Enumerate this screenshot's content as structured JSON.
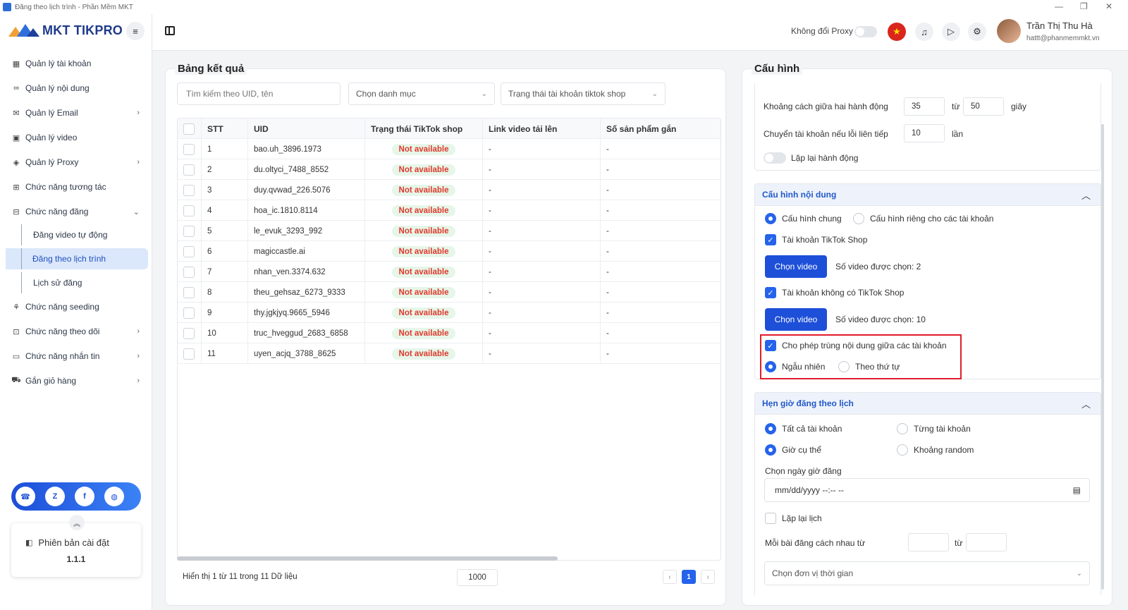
{
  "window": {
    "title": "Đăng theo lịch trình - Phần Mềm MKT"
  },
  "brand": {
    "name": "MKT TIKPRO"
  },
  "sidebar": {
    "items": [
      {
        "label": "Quản lý tài khoản"
      },
      {
        "label": "Quản lý nội dung"
      },
      {
        "label": "Quản lý Email"
      },
      {
        "label": "Quản lý video"
      },
      {
        "label": "Quản lý Proxy"
      },
      {
        "label": "Chức năng tương tác"
      },
      {
        "label": "Chức năng đăng"
      },
      {
        "label": "Chức năng seeding"
      },
      {
        "label": "Chức năng theo dõi"
      },
      {
        "label": "Chức năng nhắn tin"
      },
      {
        "label": "Gắn giỏ hàng"
      }
    ],
    "sub_items": [
      {
        "label": "Đăng video tự động"
      },
      {
        "label": "Đăng theo lịch trình"
      },
      {
        "label": "Lịch sử đăng"
      }
    ],
    "version_label": "Phiên bản cài đặt",
    "version": "1.1.1"
  },
  "topbar": {
    "proxy_label": "Không đổi Proxy",
    "user_name": "Trần Thị Thu Hà",
    "user_email": "hattt@phanmemmkt.vn"
  },
  "results": {
    "title": "Bảng kết quả",
    "search_placeholder": "Tìm kiếm theo UID, tên",
    "category_select": "Chọn danh mục",
    "status_select": "Trạng thái tài khoản tiktok shop",
    "columns": [
      "STT",
      "UID",
      "Trạng thái TikTok shop",
      "Link video tải lên",
      "Số sản phẩm gắn"
    ],
    "rows": [
      {
        "stt": "1",
        "uid": "bao.uh_3896.1973",
        "status": "Not available",
        "link": "-",
        "products": "-"
      },
      {
        "stt": "2",
        "uid": "du.oltyci_7488_8552",
        "status": "Not available",
        "link": "-",
        "products": "-"
      },
      {
        "stt": "3",
        "uid": "duy.qvwad_226.5076",
        "status": "Not available",
        "link": "-",
        "products": "-"
      },
      {
        "stt": "4",
        "uid": "hoa_ic.1810.8114",
        "status": "Not available",
        "link": "-",
        "products": "-"
      },
      {
        "stt": "5",
        "uid": "le_evuk_3293_992",
        "status": "Not available",
        "link": "-",
        "products": "-"
      },
      {
        "stt": "6",
        "uid": "magiccastle.ai",
        "status": "Not available",
        "link": "-",
        "products": "-"
      },
      {
        "stt": "7",
        "uid": "nhan_ven.3374.632",
        "status": "Not available",
        "link": "-",
        "products": "-"
      },
      {
        "stt": "8",
        "uid": "theu_gehsaz_6273_9333",
        "status": "Not available",
        "link": "-",
        "products": "-"
      },
      {
        "stt": "9",
        "uid": "thy.jgkjyq.9665_5946",
        "status": "Not available",
        "link": "-",
        "products": "-"
      },
      {
        "stt": "10",
        "uid": "truc_hveggud_2683_6858",
        "status": "Not available",
        "link": "-",
        "products": "-"
      },
      {
        "stt": "11",
        "uid": "uyen_acjq_3788_8625",
        "status": "Not available",
        "link": "-",
        "products": "-"
      }
    ],
    "footer_info": "Hiển thị 1 từ 11 trong 11 Dữ liệu",
    "page_size": "1000",
    "current_page": "1",
    "prev": "‹",
    "next": "›"
  },
  "config": {
    "title": "Cấu hình",
    "general": {
      "action_gap_label": "Khoảng cách giữa hai hành động",
      "action_gap_from": "35",
      "to_label": "từ",
      "action_gap_to": "50",
      "seconds_label": "giây",
      "switch_label": "Chuyển tài khoản nếu lỗi liên tiếp",
      "switch_value": "10",
      "times_label": "lần",
      "repeat_label": "Lặp lại hành động"
    },
    "content": {
      "header": "Cấu hình nội dung",
      "opt_common": "Cấu hình chung",
      "opt_private": "Cấu hình riêng cho các tài khoản",
      "tiktok_shop_label": "Tài khoản TikTok Shop",
      "choose_video": "Chọn video",
      "shop_count": "Số video được chọn: 2",
      "no_shop_label": "Tài khoản không có TikTok Shop",
      "no_shop_count": "Số video được chọn: 10",
      "allow_dup_label": "Cho phép trùng nội dung giữa các tài khoản",
      "random_label": "Ngẫu nhiên",
      "sequential_label": "Theo thứ tự"
    },
    "schedule": {
      "header": "Hẹn giờ đăng theo lịch",
      "all_accounts": "Tất cả tài khoản",
      "each_account": "Từng tài khoản",
      "specific_time": "Giờ cụ thể",
      "random_range": "Khoảng random",
      "choose_datetime": "Chọn ngày giờ đăng",
      "date_placeholder": "mm/dd/yyyy --:-- --",
      "repeat_schedule": "Lặp lại lịch",
      "gap_label": "Mỗi bài đăng cách nhau từ",
      "to_label": "từ",
      "unit_select": "Chọn đơn vị thời gian"
    }
  }
}
